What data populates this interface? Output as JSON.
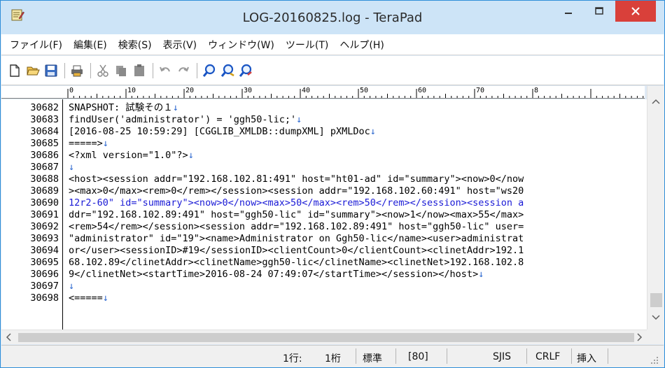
{
  "window": {
    "title": "LOG-20160825.log - TeraPad"
  },
  "menu": [
    {
      "label": "ファイル(F)"
    },
    {
      "label": "編集(E)"
    },
    {
      "label": "検索(S)"
    },
    {
      "label": "表示(V)"
    },
    {
      "label": "ウィンドウ(W)"
    },
    {
      "label": "ツール(T)"
    },
    {
      "label": "ヘルプ(H)"
    }
  ],
  "toolbar": {
    "buttons": [
      "new-file-icon",
      "open-file-icon",
      "save-icon",
      "print-icon",
      "cut-icon",
      "copy-icon",
      "paste-icon",
      "undo-icon",
      "redo-icon",
      "find-icon",
      "find-next-icon",
      "find-prev-icon"
    ]
  },
  "ruler": {
    "labels": [
      "0",
      "10",
      "20",
      "30",
      "40",
      "50",
      "60",
      "70",
      "8"
    ]
  },
  "editor": {
    "lines": [
      {
        "num": "30682",
        "text": "SNAPSHOT: 試験その１",
        "eol": "↓"
      },
      {
        "num": "30683",
        "text": "findUser('administrator') = 'ggh50-lic;'",
        "eol": "↓"
      },
      {
        "num": "30684",
        "text": "[2016-08-25 10:59:29] [CGGLIB_XMLDB::dumpXML] pXMLDoc",
        "eol": "↓"
      },
      {
        "num": "30685",
        "text": "=====>",
        "eol": "↓"
      },
      {
        "num": "30686",
        "text": "<?xml version=\"1.0\"?>",
        "eol": "↓"
      },
      {
        "num": "30687",
        "text": "",
        "eol": "↓"
      },
      {
        "num": "30688",
        "text": "<host><session addr=\"192.168.102.81:491\" host=\"ht01-ad\" id=\"summary\"><now>0</now",
        "eol": ""
      },
      {
        "num": "30689",
        "text": "><max>0</max><rem>0</rem></session><session addr=\"192.168.102.60:491\" host=\"ws20",
        "eol": ""
      },
      {
        "num": "30690",
        "text": "12r2-60\" id=\"summary\"><now>0</now><max>50</max><rem>50</rem></session><session a",
        "eol": "",
        "selected": true
      },
      {
        "num": "30691",
        "text": "ddr=\"192.168.102.89:491\" host=\"ggh50-lic\" id=\"summary\"><now>1</now><max>55</max>",
        "eol": ""
      },
      {
        "num": "30692",
        "text": "<rem>54</rem></session><session addr=\"192.168.102.89:491\" host=\"ggh50-lic\" user=",
        "eol": ""
      },
      {
        "num": "30693",
        "text": "\"administrator\" id=\"19\"><name>Administrator on Ggh50-lic</name><user>administrat",
        "eol": ""
      },
      {
        "num": "30694",
        "text": "or</user><sessionID>#19</sessionID><clientCount>0</clientCount><clinetAddr>192.1",
        "eol": ""
      },
      {
        "num": "30695",
        "text": "68.102.89</clinetAddr><clinetName>ggh50-lic</clinetName><clinetNet>192.168.102.8",
        "eol": ""
      },
      {
        "num": "30696",
        "text": "9</clinetNet><startTime>2016-08-24 07:49:07</startTime></session></host>",
        "eol": "↓"
      },
      {
        "num": "30697",
        "text": "",
        "eol": "↓"
      },
      {
        "num": "30698",
        "text": "<=====",
        "eol": "↓"
      }
    ]
  },
  "status": {
    "line": "1行:",
    "col": "1桁",
    "mode": "標準",
    "code": "[80]",
    "encoding": "SJIS",
    "newline": "CRLF",
    "insert": "挿入"
  },
  "colors": {
    "titlebar": "#cde4f7",
    "close_button": "#d9403a",
    "selected_text": "#1a1ad6",
    "eol_mark": "#2f6ad0"
  }
}
